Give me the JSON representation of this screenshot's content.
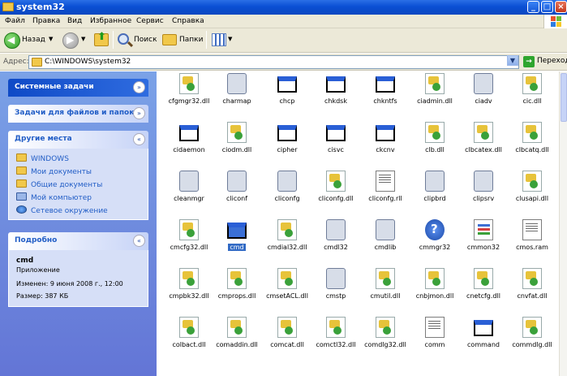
{
  "window": {
    "title": "system32"
  },
  "menu": [
    "Файл",
    "Правка",
    "Вид",
    "Избранное",
    "Сервис",
    "Справка"
  ],
  "toolbar": {
    "back": "Назад",
    "search": "Поиск",
    "folders": "Папки"
  },
  "address": {
    "label": "Адрес:",
    "path": "C:\\WINDOWS\\system32",
    "go": "Переход"
  },
  "sidebar": {
    "system_tasks": "Системные задачи",
    "file_tasks": "Задачи для файлов и папок",
    "other_places": {
      "title": "Другие места",
      "items": [
        "WINDOWS",
        "Мои документы",
        "Общие документы",
        "Мой компьютер",
        "Сетевое окружение"
      ]
    },
    "details": {
      "title": "Подробно",
      "name": "cmd",
      "type": "Приложение",
      "modified": "Изменен: 9 июня 2008 г., 12:00",
      "size": "Размер: 387 КБ"
    }
  },
  "files": [
    {
      "name": "cfgmgr32.dll",
      "icon": "dll-icon"
    },
    {
      "name": "charmap",
      "icon": "charmap-icon"
    },
    {
      "name": "chcp",
      "icon": "console-app-icon"
    },
    {
      "name": "chkdsk",
      "icon": "console-app-icon"
    },
    {
      "name": "chkntfs",
      "icon": "console-app-icon"
    },
    {
      "name": "ciadmin.dll",
      "icon": "dll-icon"
    },
    {
      "name": "ciadv",
      "icon": "ciadv-icon"
    },
    {
      "name": "cic.dll",
      "icon": "dll-icon"
    },
    {
      "name": "cidaemon",
      "icon": "console-app-icon"
    },
    {
      "name": "ciodm.dll",
      "icon": "dll-icon"
    },
    {
      "name": "cipher",
      "icon": "console-app-icon"
    },
    {
      "name": "cisvc",
      "icon": "console-app-icon"
    },
    {
      "name": "ckcnv",
      "icon": "console-app-icon"
    },
    {
      "name": "clb.dll",
      "icon": "dll-icon"
    },
    {
      "name": "clbcatex.dll",
      "icon": "dll-icon"
    },
    {
      "name": "clbcatq.dll",
      "icon": "dll-icon"
    },
    {
      "name": "cleanmgr",
      "icon": "cleanmgr-icon"
    },
    {
      "name": "cliconf",
      "icon": "help-file-icon"
    },
    {
      "name": "cliconfg",
      "icon": "computer-icon"
    },
    {
      "name": "cliconfg.dll",
      "icon": "dll-icon"
    },
    {
      "name": "cliconfg.rll",
      "icon": "text-file-icon"
    },
    {
      "name": "clipbrd",
      "icon": "clipbrd-icon"
    },
    {
      "name": "clipsrv",
      "icon": "clipsrv-icon"
    },
    {
      "name": "clusapi.dll",
      "icon": "dll-icon"
    },
    {
      "name": "cmcfg32.dll",
      "icon": "dll-icon"
    },
    {
      "name": "cmd",
      "icon": "cmd-icon",
      "selected": true
    },
    {
      "name": "cmdial32.dll",
      "icon": "dll-icon"
    },
    {
      "name": "cmdl32",
      "icon": "cmdl32-icon"
    },
    {
      "name": "cmdlib",
      "icon": "cmdlib-icon"
    },
    {
      "name": "cmmgr32",
      "icon": "help-icon"
    },
    {
      "name": "cmmon32",
      "icon": "cmmon32-icon"
    },
    {
      "name": "cmos.ram",
      "icon": "text-file-icon"
    },
    {
      "name": "cmpbk32.dll",
      "icon": "dll-icon"
    },
    {
      "name": "cmprops.dll",
      "icon": "dll-icon"
    },
    {
      "name": "cmsetACL.dll",
      "icon": "dll-icon"
    },
    {
      "name": "cmstp",
      "icon": "cmstp-icon"
    },
    {
      "name": "cmutil.dll",
      "icon": "dll-icon"
    },
    {
      "name": "cnbjmon.dll",
      "icon": "dll-icon"
    },
    {
      "name": "cnetcfg.dll",
      "icon": "dll-icon"
    },
    {
      "name": "cnvfat.dll",
      "icon": "dll-icon"
    },
    {
      "name": "colbact.dll",
      "icon": "dll-icon"
    },
    {
      "name": "comaddin.dll",
      "icon": "dll-icon"
    },
    {
      "name": "comcat.dll",
      "icon": "dll-icon"
    },
    {
      "name": "comctl32.dll",
      "icon": "dll-icon"
    },
    {
      "name": "comdlg32.dll",
      "icon": "dll-icon"
    },
    {
      "name": "comm",
      "icon": "text-file-icon"
    },
    {
      "name": "command",
      "icon": "console-app-icon"
    },
    {
      "name": "commdlg.dll",
      "icon": "dll-icon"
    }
  ]
}
